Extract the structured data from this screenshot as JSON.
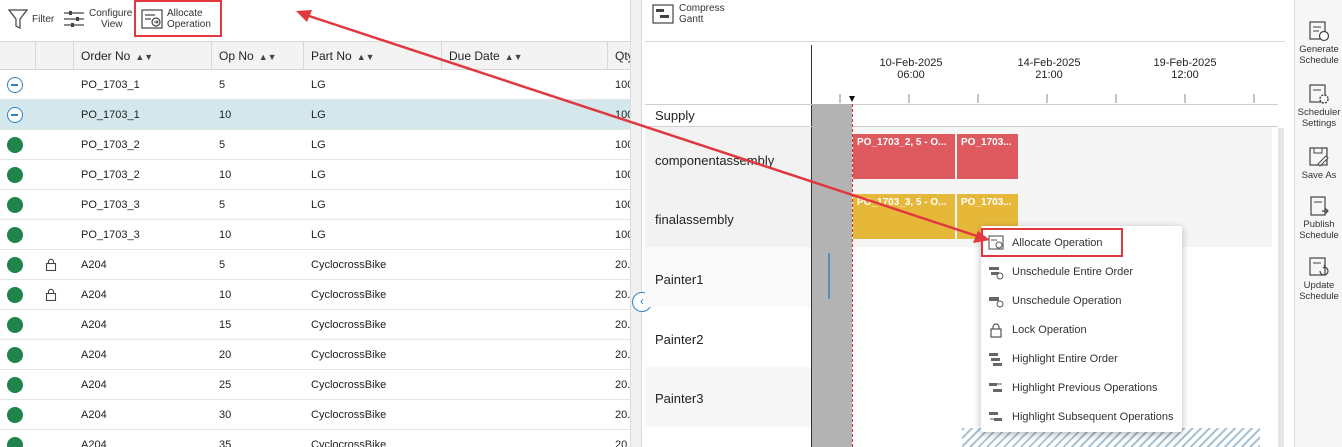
{
  "toolbar": {
    "filter_label": "Filter",
    "configure_label_1": "Configure",
    "configure_label_2": "View",
    "allocate_label_1": "Allocate",
    "allocate_label_2": "Operation",
    "compress_label_1": "Compress",
    "compress_label_2": "Gantt"
  },
  "grid": {
    "columns": [
      "Order No",
      "Op No",
      "Part No",
      "Due Date",
      "Qty"
    ],
    "rows": [
      {
        "status": "unscheduled",
        "locked": false,
        "order": "PO_1703_1",
        "op": "5",
        "part": "LG",
        "due": "",
        "qty": "100"
      },
      {
        "status": "unscheduled",
        "locked": false,
        "order": "PO_1703_1",
        "op": "10",
        "part": "LG",
        "due": "",
        "qty": "100",
        "selected": true
      },
      {
        "status": "scheduled",
        "locked": false,
        "order": "PO_1703_2",
        "op": "5",
        "part": "LG",
        "due": "",
        "qty": "100"
      },
      {
        "status": "scheduled",
        "locked": false,
        "order": "PO_1703_2",
        "op": "10",
        "part": "LG",
        "due": "",
        "qty": "100"
      },
      {
        "status": "scheduled",
        "locked": false,
        "order": "PO_1703_3",
        "op": "5",
        "part": "LG",
        "due": "",
        "qty": "100"
      },
      {
        "status": "scheduled",
        "locked": false,
        "order": "PO_1703_3",
        "op": "10",
        "part": "LG",
        "due": "",
        "qty": "100"
      },
      {
        "status": "scheduled",
        "locked": true,
        "order": "A204",
        "op": "5",
        "part": "CyclocrossBike",
        "due": "",
        "qty": "20."
      },
      {
        "status": "scheduled",
        "locked": true,
        "order": "A204",
        "op": "10",
        "part": "CyclocrossBike",
        "due": "",
        "qty": "20."
      },
      {
        "status": "scheduled",
        "locked": false,
        "order": "A204",
        "op": "15",
        "part": "CyclocrossBike",
        "due": "",
        "qty": "20."
      },
      {
        "status": "scheduled",
        "locked": false,
        "order": "A204",
        "op": "20",
        "part": "CyclocrossBike",
        "due": "",
        "qty": "20."
      },
      {
        "status": "scheduled",
        "locked": false,
        "order": "A204",
        "op": "25",
        "part": "CyclocrossBike",
        "due": "",
        "qty": "20."
      },
      {
        "status": "scheduled",
        "locked": false,
        "order": "A204",
        "op": "30",
        "part": "CyclocrossBike",
        "due": "",
        "qty": "20."
      },
      {
        "status": "scheduled",
        "locked": false,
        "order": "A204",
        "op": "35",
        "part": "CyclocrossBike",
        "due": "",
        "qty": "20."
      }
    ]
  },
  "gantt": {
    "timescale": [
      {
        "date": "10-Feb-2025",
        "time": "06:00"
      },
      {
        "date": "14-Feb-2025",
        "time": "21:00"
      },
      {
        "date": "19-Feb-2025",
        "time": "12:00"
      }
    ],
    "section_label": "Supply",
    "resources": [
      "componentassembly",
      "finalassembly",
      "Painter1",
      "Painter2",
      "Painter3"
    ],
    "bars": {
      "ca_1": "PO_1703_2, 5 - O...",
      "ca_2": "PO_1703...",
      "fa_1": "PO_1703_3, 5 - O...",
      "fa_2": "PO_1703..."
    }
  },
  "context_menu": {
    "items": [
      "Allocate Operation",
      "Unschedule Entire Order",
      "Unschedule Operation",
      "Lock Operation",
      "Highlight Entire Order",
      "Highlight Previous Operations",
      "Highlight Subsequent Operations"
    ]
  },
  "rail": {
    "generate_1": "Generate",
    "generate_2": "Schedule",
    "settings_1": "Scheduler",
    "settings_2": "Settings",
    "saveas": "Save As",
    "publish_1": "Publish",
    "publish_2": "Schedule",
    "update_1": "Update",
    "update_2": "Schedule"
  },
  "colors": {
    "scheduled": "#1e8449",
    "unscheduled": "#2c82c9",
    "bar_red": "#de5a5e",
    "bar_yellow": "#e6b83a",
    "highlight": "#e0383e",
    "selected_row": "#d3e7ed"
  }
}
